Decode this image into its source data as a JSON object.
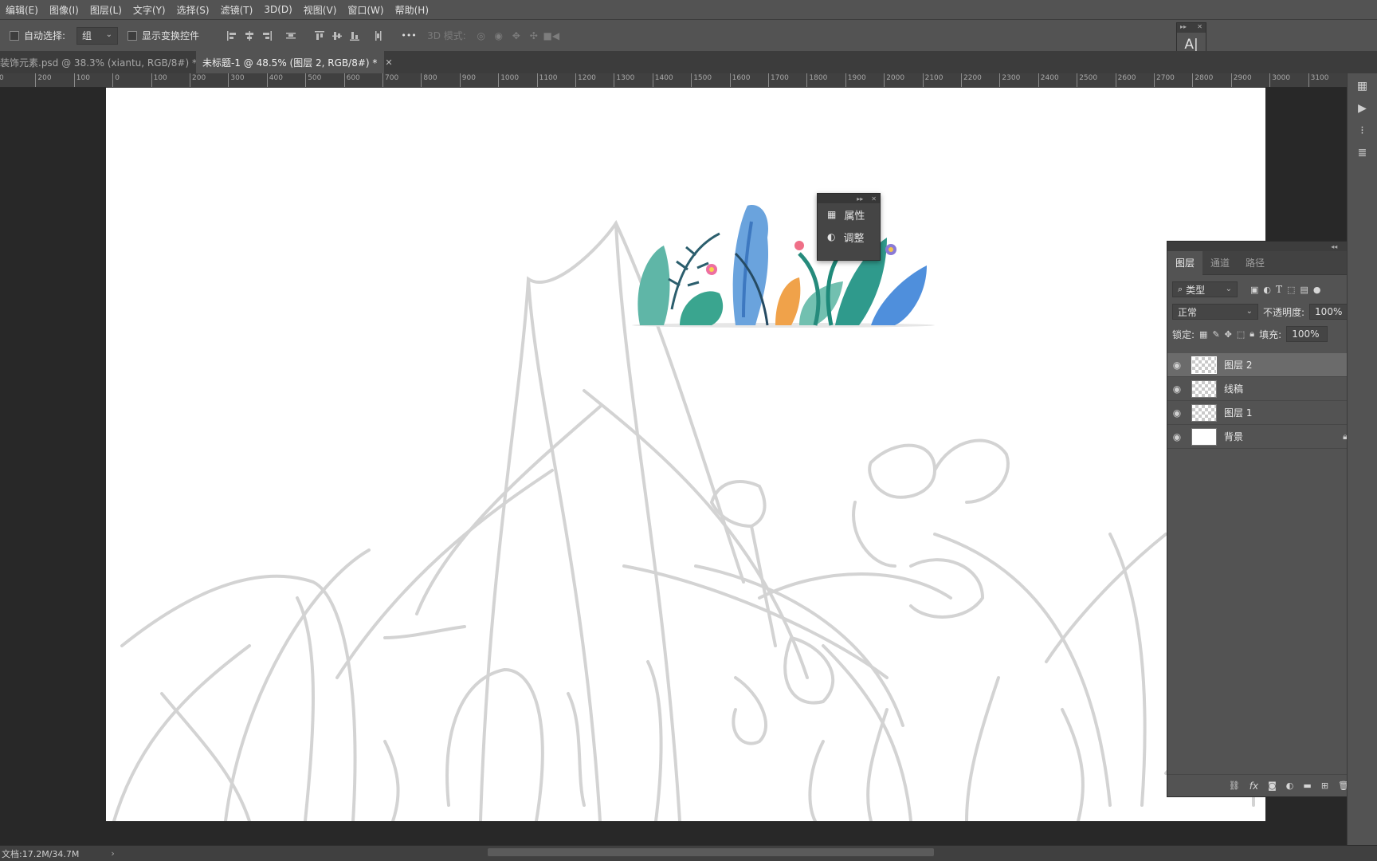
{
  "menu": [
    "编辑(E)",
    "图像(I)",
    "图层(L)",
    "文字(Y)",
    "选择(S)",
    "滤镜(T)",
    "3D(D)",
    "视图(V)",
    "窗口(W)",
    "帮助(H)"
  ],
  "options": {
    "auto_select_label": "自动选择:",
    "auto_select_value": "组",
    "show_transform_label": "显示变换控件",
    "mode_3d_label": "3D 模式:",
    "more_label": "•••"
  },
  "tabs": [
    {
      "label": "装饰元素.psd @ 38.3% (xiantu, RGB/8#) *",
      "active": false
    },
    {
      "label": "未标题-1 @ 48.5% (图层 2, RGB/8#) *",
      "active": true
    }
  ],
  "ruler": {
    "ticks": [
      "0",
      "200",
      "100",
      "0",
      "100",
      "200",
      "300",
      "400",
      "500",
      "600",
      "700",
      "800",
      "900",
      "1000",
      "1100",
      "1200",
      "1300",
      "1400",
      "1500",
      "1600",
      "1700",
      "1800",
      "1900",
      "2000",
      "2100",
      "2200",
      "2300",
      "2400",
      "2500",
      "2600",
      "2700",
      "2800",
      "2900",
      "3000",
      "3100"
    ]
  },
  "char_panel": {
    "char_icon": "A|",
    "para_icon": "¶"
  },
  "popup": {
    "properties_label": "属性",
    "adjust_label": "调整"
  },
  "layers_panel": {
    "tabs": [
      "图层",
      "通道",
      "路径"
    ],
    "filter_type": "类型",
    "blend_mode": "正常",
    "opacity_label": "不透明度:",
    "opacity_value": "100%",
    "lock_label": "锁定:",
    "fill_label": "填充:",
    "fill_value": "100%",
    "layers": [
      {
        "name": "图层 2",
        "selected": true,
        "thumb": "transparent"
      },
      {
        "name": "线稿",
        "selected": false,
        "thumb": "transparent"
      },
      {
        "name": "图层 1",
        "selected": false,
        "thumb": "transparent"
      },
      {
        "name": "背景",
        "selected": false,
        "thumb": "white",
        "locked": true
      }
    ]
  },
  "status": {
    "doc_size": "文档:17.2M/34.7M"
  },
  "colors": {
    "menu_bg": "#535353",
    "workspace_bg": "#282828",
    "selected_layer_bg": "#6b6b6b"
  }
}
